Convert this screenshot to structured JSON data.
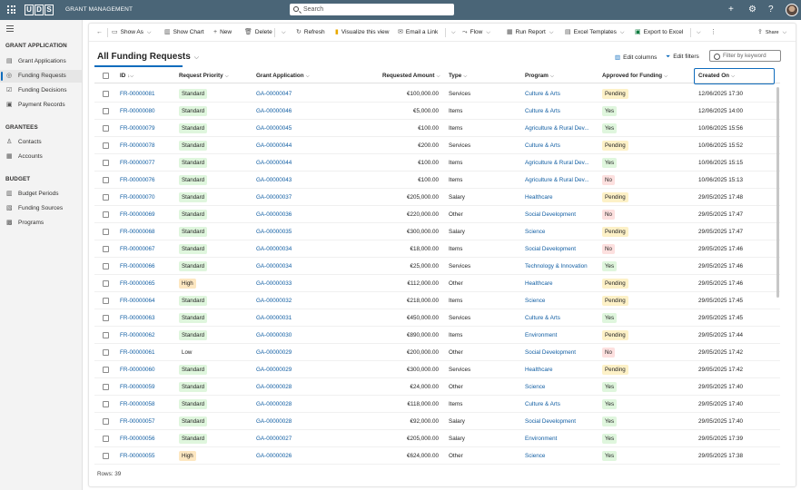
{
  "topbar": {
    "logo_letters": [
      "U",
      "D",
      "S"
    ],
    "app_name": "GRANT MANAGEMENT",
    "search_placeholder": "Search",
    "icons": [
      "plus-icon",
      "gear-icon",
      "help-icon"
    ]
  },
  "sidebar": {
    "groups": [
      {
        "title": "GRANT APPLICATION",
        "items": [
          {
            "label": "Grant Applications",
            "icon": "document-icon",
            "active": false
          },
          {
            "label": "Funding Requests",
            "icon": "money-icon",
            "active": true
          },
          {
            "label": "Funding Decisions",
            "icon": "check-icon",
            "active": false
          },
          {
            "label": "Payment Records",
            "icon": "receipt-icon",
            "active": false
          }
        ]
      },
      {
        "title": "GRANTEES",
        "items": [
          {
            "label": "Contacts",
            "icon": "person-icon",
            "active": false
          },
          {
            "label": "Accounts",
            "icon": "building-icon",
            "active": false
          }
        ]
      },
      {
        "title": "BUDGET",
        "items": [
          {
            "label": "Budget Periods",
            "icon": "calendar-icon",
            "active": false
          },
          {
            "label": "Funding Sources",
            "icon": "source-icon",
            "active": false
          },
          {
            "label": "Programs",
            "icon": "program-icon",
            "active": false
          }
        ]
      }
    ]
  },
  "commandbar": {
    "items": [
      {
        "label": "Show As",
        "icon": "show-as-icon",
        "caret": true
      },
      {
        "label": "Show Chart",
        "icon": "chart-icon",
        "caret": false
      },
      {
        "label": "New",
        "icon": "plus-icon",
        "caret": false
      },
      {
        "label": "Delete",
        "icon": "trash-icon",
        "caret": true
      },
      {
        "label": "Refresh",
        "icon": "refresh-icon",
        "caret": false
      },
      {
        "label": "Visualize this view",
        "icon": "visualize-icon",
        "caret": false
      },
      {
        "label": "Email a Link",
        "icon": "mail-icon",
        "caret": true
      },
      {
        "label": "Flow",
        "icon": "flow-icon",
        "caret": true
      },
      {
        "label": "Run Report",
        "icon": "report-icon",
        "caret": true
      },
      {
        "label": "Excel Templates",
        "icon": "excel-template-icon",
        "caret": true
      },
      {
        "label": "Export to Excel",
        "icon": "excel-icon",
        "caret": true
      }
    ],
    "share_label": "Share"
  },
  "view": {
    "title": "All Funding Requests",
    "edit_columns": "Edit columns",
    "edit_filters": "Edit filters",
    "filter_placeholder": "Filter by keyword"
  },
  "table": {
    "columns": {
      "id": "ID",
      "priority": "Request Priority",
      "application": "Grant Application",
      "amount": "Requested Amount",
      "type": "Type",
      "program": "Program",
      "approved": "Approved for Funding",
      "created": "Created On"
    },
    "rows": [
      {
        "id": "FR-00000081",
        "priority": "Standard",
        "application": "GA-00000047",
        "amount": "€100,000.00",
        "type": "Services",
        "program": "Culture & Arts",
        "approved": "Pending",
        "created": "12/06/2025 17:30"
      },
      {
        "id": "FR-00000080",
        "priority": "Standard",
        "application": "GA-00000046",
        "amount": "€5,000.00",
        "type": "Items",
        "program": "Culture & Arts",
        "approved": "Yes",
        "created": "12/06/2025 14:00"
      },
      {
        "id": "FR-00000079",
        "priority": "Standard",
        "application": "GA-00000045",
        "amount": "€100.00",
        "type": "Items",
        "program": "Agriculture & Rural Dev...",
        "approved": "Yes",
        "created": "10/06/2025 15:56"
      },
      {
        "id": "FR-00000078",
        "priority": "Standard",
        "application": "GA-00000044",
        "amount": "€200.00",
        "type": "Services",
        "program": "Culture & Arts",
        "approved": "Pending",
        "created": "10/06/2025 15:52"
      },
      {
        "id": "FR-00000077",
        "priority": "Standard",
        "application": "GA-00000044",
        "amount": "€100.00",
        "type": "Items",
        "program": "Agriculture & Rural Dev...",
        "approved": "Yes",
        "created": "10/06/2025 15:15"
      },
      {
        "id": "FR-00000076",
        "priority": "Standard",
        "application": "GA-00000043",
        "amount": "€100.00",
        "type": "Items",
        "program": "Agriculture & Rural Dev...",
        "approved": "No",
        "created": "10/06/2025 15:13"
      },
      {
        "id": "FR-00000070",
        "priority": "Standard",
        "application": "GA-00000037",
        "amount": "€205,000.00",
        "type": "Salary",
        "program": "Healthcare",
        "approved": "Pending",
        "created": "29/05/2025 17:48"
      },
      {
        "id": "FR-00000069",
        "priority": "Standard",
        "application": "GA-00000036",
        "amount": "€220,000.00",
        "type": "Other",
        "program": "Social Development",
        "approved": "No",
        "created": "29/05/2025 17:47"
      },
      {
        "id": "FR-00000068",
        "priority": "Standard",
        "application": "GA-00000035",
        "amount": "€300,000.00",
        "type": "Salary",
        "program": "Science",
        "approved": "Pending",
        "created": "29/05/2025 17:47"
      },
      {
        "id": "FR-00000067",
        "priority": "Standard",
        "application": "GA-00000034",
        "amount": "€18,000.00",
        "type": "Items",
        "program": "Social Development",
        "approved": "No",
        "created": "29/05/2025 17:46"
      },
      {
        "id": "FR-00000066",
        "priority": "Standard",
        "application": "GA-00000034",
        "amount": "€25,000.00",
        "type": "Services",
        "program": "Technology & Innovation",
        "approved": "Yes",
        "created": "29/05/2025 17:46"
      },
      {
        "id": "FR-00000065",
        "priority": "High",
        "application": "GA-00000033",
        "amount": "€112,000.00",
        "type": "Other",
        "program": "Healthcare",
        "approved": "Pending",
        "created": "29/05/2025 17:46"
      },
      {
        "id": "FR-00000064",
        "priority": "Standard",
        "application": "GA-00000032",
        "amount": "€218,000.00",
        "type": "Items",
        "program": "Science",
        "approved": "Pending",
        "created": "29/05/2025 17:45"
      },
      {
        "id": "FR-00000063",
        "priority": "Standard",
        "application": "GA-00000031",
        "amount": "€450,000.00",
        "type": "Services",
        "program": "Culture & Arts",
        "approved": "Yes",
        "created": "29/05/2025 17:45"
      },
      {
        "id": "FR-00000062",
        "priority": "Standard",
        "application": "GA-00000030",
        "amount": "€890,000.00",
        "type": "Items",
        "program": "Environment",
        "approved": "Pending",
        "created": "29/05/2025 17:44"
      },
      {
        "id": "FR-00000061",
        "priority": "Low",
        "application": "GA-00000029",
        "amount": "€200,000.00",
        "type": "Other",
        "program": "Social Development",
        "approved": "No",
        "created": "29/05/2025 17:42"
      },
      {
        "id": "FR-00000060",
        "priority": "Standard",
        "application": "GA-00000029",
        "amount": "€300,000.00",
        "type": "Services",
        "program": "Healthcare",
        "approved": "Pending",
        "created": "29/05/2025 17:42"
      },
      {
        "id": "FR-00000059",
        "priority": "Standard",
        "application": "GA-00000028",
        "amount": "€24,000.00",
        "type": "Other",
        "program": "Science",
        "approved": "Yes",
        "created": "29/05/2025 17:40"
      },
      {
        "id": "FR-00000058",
        "priority": "Standard",
        "application": "GA-00000028",
        "amount": "€118,000.00",
        "type": "Items",
        "program": "Culture & Arts",
        "approved": "Yes",
        "created": "29/05/2025 17:40"
      },
      {
        "id": "FR-00000057",
        "priority": "Standard",
        "application": "GA-00000028",
        "amount": "€92,000.00",
        "type": "Salary",
        "program": "Social Development",
        "approved": "Yes",
        "created": "29/05/2025 17:40"
      },
      {
        "id": "FR-00000056",
        "priority": "Standard",
        "application": "GA-00000027",
        "amount": "€205,000.00",
        "type": "Salary",
        "program": "Environment",
        "approved": "Yes",
        "created": "29/05/2025 17:39"
      },
      {
        "id": "FR-00000055",
        "priority": "High",
        "application": "GA-00000026",
        "amount": "€624,000.00",
        "type": "Other",
        "program": "Science",
        "approved": "Yes",
        "created": "29/05/2025 17:38"
      }
    ],
    "footer": "Rows: 39"
  },
  "colors": {
    "topbar": "#4a6577",
    "accent": "#0f6cbd",
    "link": "#115ea3",
    "standard_badge": "#dff6dd",
    "high_badge": "#fde7c1",
    "pending_badge": "#fdf1c7",
    "no_badge": "#fde0df"
  }
}
